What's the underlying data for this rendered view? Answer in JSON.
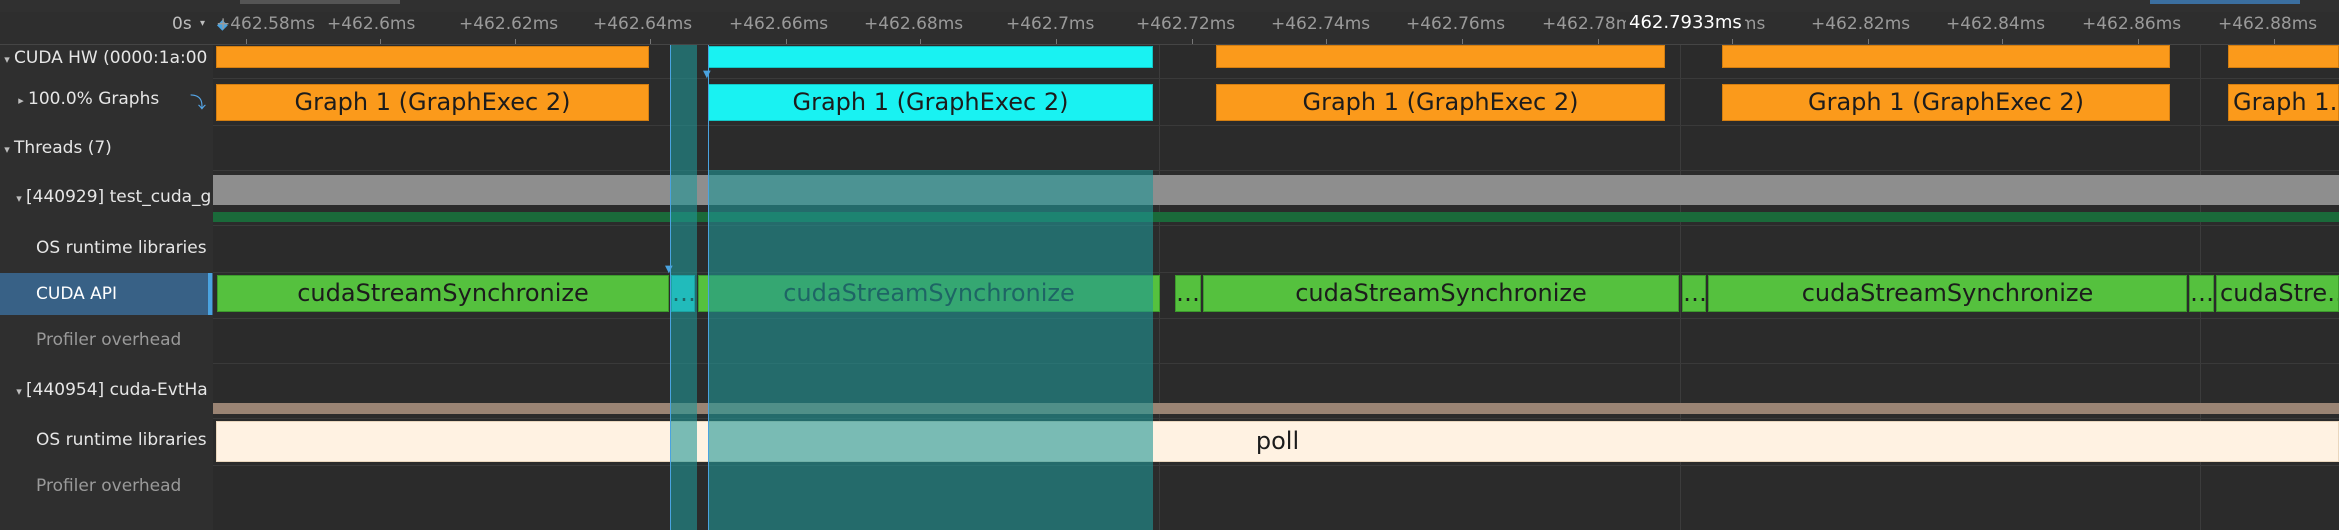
{
  "ruler": {
    "zero_label": "0s",
    "ticks": [
      "+462.58ms",
      "+462.6ms",
      "+462.62ms",
      "+462.64ms",
      "+462.66ms",
      "+462.68ms",
      "+462.7ms",
      "+462.72ms",
      "+462.74ms",
      "+462.76ms",
      "+462.78ms",
      "+462.8ms",
      "+462.82ms",
      "+462.84ms",
      "+462.86ms",
      "+462.88ms"
    ],
    "cursor_time": "462.7933ms"
  },
  "rows": {
    "cuda_hw": "CUDA HW (0000:1a:00",
    "graphs": "100.0% Graphs",
    "threads": "Threads (7)",
    "thread1": "[440929] test_cuda_g",
    "os_runtime_1": "OS runtime libraries",
    "cuda_api": "CUDA API",
    "profiler_overhead_1": "Profiler overhead",
    "thread2": "[440954] cuda-EvtHa",
    "os_runtime_2": "OS runtime libraries",
    "profiler_overhead_2": "Profiler overhead"
  },
  "graph_bars": [
    "Graph 1 (GraphExec 2)",
    "Graph 1 (GraphExec 2)",
    "Graph 1 (GraphExec 2)",
    "Graph 1 (GraphExec 2)",
    "Graph 1…"
  ],
  "api_bars": [
    "cudaStreamSynchronize",
    "…",
    "cudaStreamSynchronize",
    "…",
    "cudaStreamSynchronize",
    "…",
    "cudaStreamSynchronize",
    "…",
    "cudaStre…"
  ],
  "poll_label": "poll",
  "colors": {
    "graph": "#fb9a1b",
    "graph_selected": "#19f2f2",
    "api": "#55c13e",
    "selection_highlight": "#208f8f",
    "poll": "#fff2e2",
    "selected_row": "#386186"
  },
  "icons": {
    "caret_expanded": "▾",
    "caret_collapsed": "▸",
    "sync": "⤵"
  }
}
